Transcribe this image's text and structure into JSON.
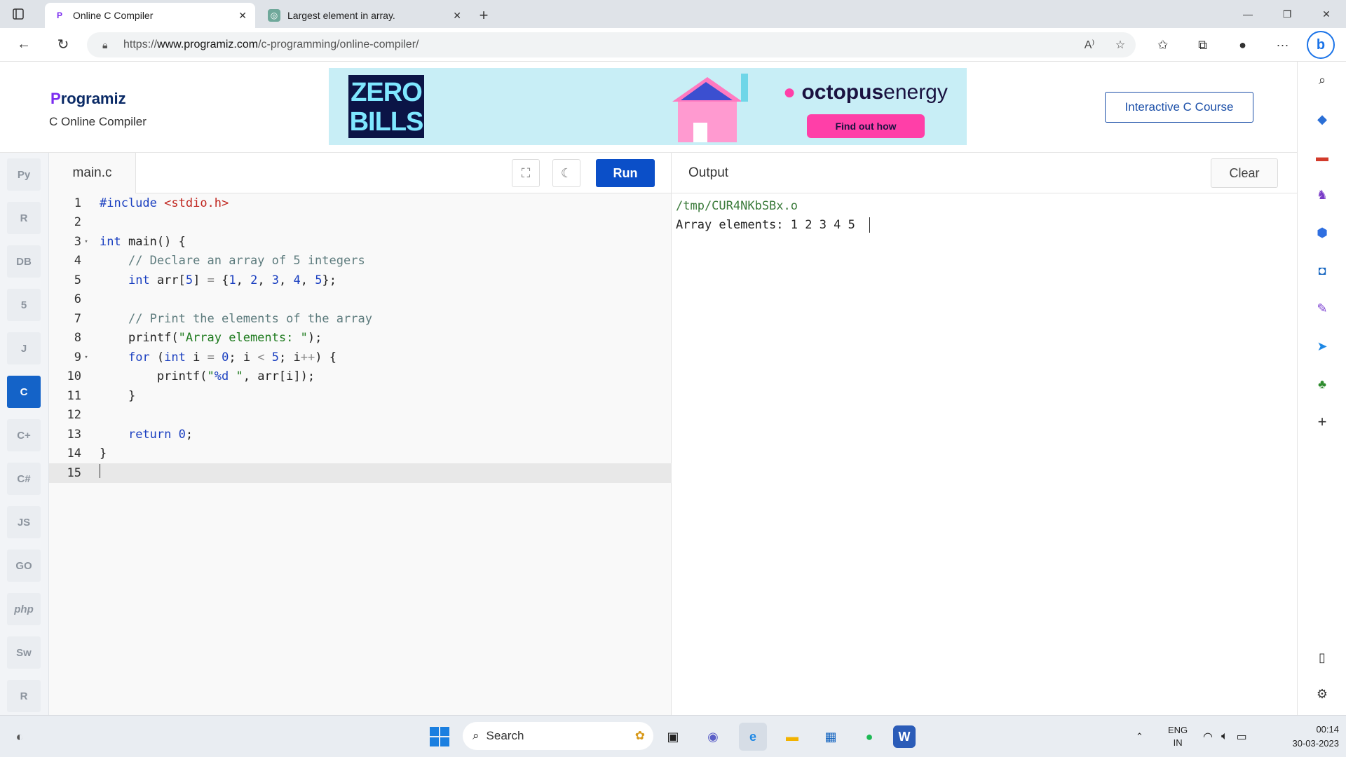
{
  "browser": {
    "tabs": [
      {
        "title": "Online C Compiler",
        "active": true
      },
      {
        "title": "Largest element in array.",
        "active": false
      }
    ],
    "url_prefix": "https://",
    "url_domain": "www.programiz.com",
    "url_path": "/c-programming/online-compiler/"
  },
  "header": {
    "logo_text": "rogramiz",
    "logo_letter": "P",
    "subtitle": "C Online Compiler",
    "ad_zero_bills_1": "ZERO",
    "ad_zero_bills_2": "BILLS",
    "ad_brand_strong": "octopus",
    "ad_brand_light": "energy",
    "ad_cta": "Find out how",
    "course_button": "Interactive C Course"
  },
  "languages": [
    {
      "name": "python-icon",
      "label": "Py"
    },
    {
      "name": "r-icon",
      "label": "R"
    },
    {
      "name": "sql-icon",
      "label": "DB"
    },
    {
      "name": "html-icon",
      "label": "5"
    },
    {
      "name": "java-icon",
      "label": "J"
    },
    {
      "name": "c-icon",
      "label": "C"
    },
    {
      "name": "cpp-icon",
      "label": "C+"
    },
    {
      "name": "csharp-icon",
      "label": "C#"
    },
    {
      "name": "js-icon",
      "label": "JS"
    },
    {
      "name": "go-icon",
      "label": "GO"
    },
    {
      "name": "php-icon",
      "label": "php"
    },
    {
      "name": "swift-icon",
      "label": "Sw"
    },
    {
      "name": "rust-icon",
      "label": "R"
    }
  ],
  "editor": {
    "filename": "main.c",
    "run_label": "Run",
    "code": [
      "#include <stdio.h>",
      "",
      "int main() {",
      "    // Declare an array of 5 integers",
      "    int arr[5] = {1, 2, 3, 4, 5};",
      "",
      "    // Print the elements of the array",
      "    printf(\"Array elements: \");",
      "    for (int i = 0; i < 5; i++) {",
      "        printf(\"%d \", arr[i]);",
      "    }",
      "",
      "    return 0;",
      "}",
      ""
    ]
  },
  "output": {
    "title": "Output",
    "clear_label": "Clear",
    "lines": [
      "/tmp/CUR4NKbSBx.o",
      "Array elements: 1 2 3 4 5 "
    ]
  },
  "taskbar": {
    "search_placeholder": "Search",
    "lang_line1": "ENG",
    "lang_line2": "IN",
    "time": "00:14",
    "date": "30-03-2023"
  },
  "colors": {
    "accent": "#0b4fc8",
    "active_lang": "#1463c8"
  }
}
